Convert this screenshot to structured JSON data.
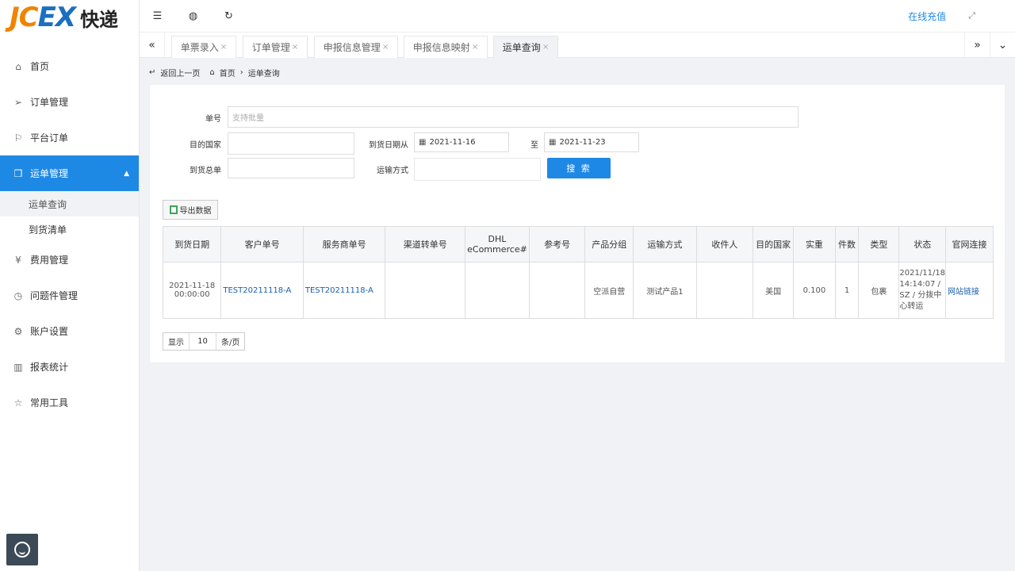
{
  "brand": {
    "logo_latin": "JCEX",
    "logo_cn": "快递"
  },
  "topbar": {
    "menu_icon": "collapse-menu-icon",
    "globe_icon": "globe-icon",
    "refresh_icon": "refresh-icon",
    "recharge": "在线充值",
    "fullscreen_icon": "fullscreen-icon"
  },
  "sidebar": {
    "items": [
      {
        "label": "首页",
        "icon": "home-icon",
        "glyph": "⌂"
      },
      {
        "label": "订单管理",
        "icon": "send-icon",
        "glyph": "➢"
      },
      {
        "label": "平台订单",
        "icon": "flag-icon",
        "glyph": "⚐"
      },
      {
        "label": "运单管理",
        "icon": "box-icon",
        "glyph": "❒"
      },
      {
        "label": "费用管理",
        "icon": "yen-icon",
        "glyph": "¥"
      },
      {
        "label": "问题件管理",
        "icon": "clock-icon",
        "glyph": "◷"
      },
      {
        "label": "账户设置",
        "icon": "gear-icon",
        "glyph": "⚙"
      },
      {
        "label": "报表统计",
        "icon": "report-icon",
        "glyph": "▥"
      },
      {
        "label": "常用工具",
        "icon": "star-icon",
        "glyph": "☆"
      }
    ],
    "sub_items": [
      {
        "label": "运单查询"
      },
      {
        "label": "到货清单"
      }
    ]
  },
  "tabs": [
    {
      "label": "单票录入"
    },
    {
      "label": "订单管理"
    },
    {
      "label": "申报信息管理"
    },
    {
      "label": "申报信息映射"
    },
    {
      "label": "运单查询"
    }
  ],
  "breadcrumb": {
    "back": "返回上一页",
    "home": "首页",
    "current": "运单查询"
  },
  "form": {
    "order_no_label": "单号",
    "order_no_placeholder": "支持批量",
    "country_label": "目的国家",
    "country_value": "",
    "date_from_label": "到货日期从",
    "date_from": "2021-11-16",
    "date_to_label": "至",
    "date_to": "2021-11-23",
    "master_label": "到货总单",
    "master_value": "",
    "transport_label": "运输方式",
    "transport_value": "",
    "search_button": "搜 索",
    "export_button": "导出数据"
  },
  "table": {
    "headers": [
      "到货日期",
      "客户单号",
      "服务商单号",
      "渠道转单号",
      "DHL eCommerce#",
      "参考号",
      "产品分组",
      "运输方式",
      "收件人",
      "目的国家",
      "实重",
      "件数",
      "类型",
      "状态",
      "官网连接"
    ],
    "rows": [
      {
        "date": "2021-11-18 00:00:00",
        "customer_no": "TEST20211118-A",
        "provider_no": "TEST20211118-A",
        "channel_no": "",
        "dhl_no": "",
        "ref_no": "",
        "product_group": "空派自营",
        "transport": "测试产品1",
        "recipient": "",
        "country": "美国",
        "weight": "0.100",
        "pieces": "1",
        "type": "包裹",
        "status": "2021/11/18 14:14:07 / SZ / 分拨中心转运",
        "link": "网站链接"
      }
    ]
  },
  "pager": {
    "show": "显示",
    "size": "10",
    "unit": "条/页"
  },
  "colors": {
    "accent": "#1e88e5",
    "logo_orange": "#f08300",
    "logo_blue": "#1a6fc0"
  }
}
